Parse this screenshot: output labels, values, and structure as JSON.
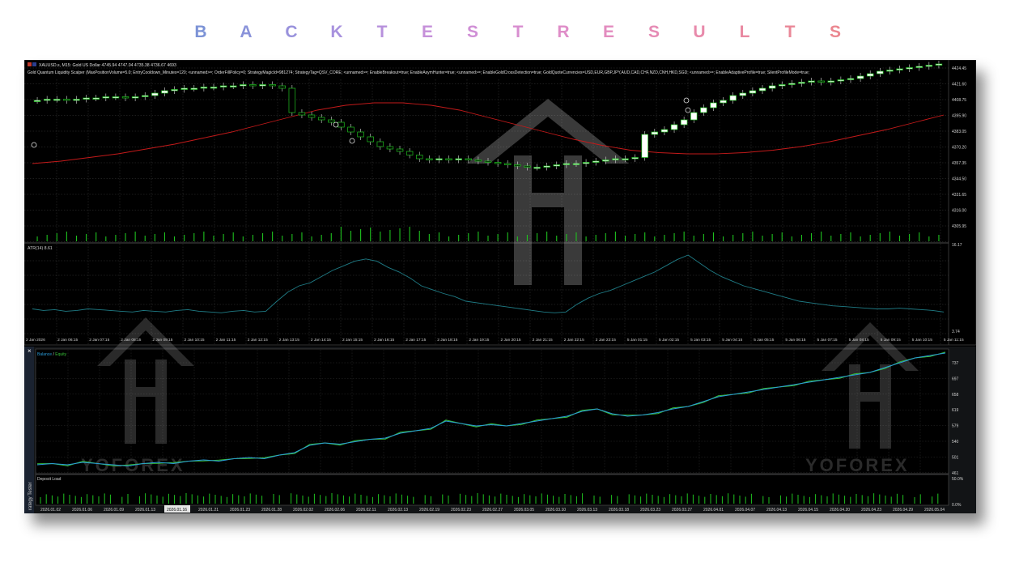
{
  "banner": {
    "letters": [
      "B",
      "A",
      "C",
      "K",
      "T",
      "E",
      "S",
      "T",
      "R",
      "E",
      "S",
      "U",
      "L",
      "T",
      "S"
    ],
    "colors": [
      "#7c93d6",
      "#8a93da",
      "#9992dc",
      "#a892de",
      "#b791dc",
      "#c690da",
      "#d08fd6",
      "#d88ed0",
      "#df8dc8",
      "#e38cbf",
      "#e68bb5",
      "#e88aab",
      "#e989a1",
      "#ea8898",
      "#eb8790"
    ]
  },
  "chart_window": {
    "symbol_line": "XAUUSD.s, M15: Gold US Dollar  4745.94 4747.04 4735.38 4736.67  4693",
    "ea_line": "Gold Quantum Liquidity Scalper (MaxPositionVolume=5.0; EntryCooldown_Minutes=120; <unnamed>=; OrderFillPolicy=0; StrategyMagicId=981274; StrategyTag=QSV_CORE; <unnamed>=; EnableBreakout=true; EnableAsymHunter=true; <unnamed>=; EnableGoldCrossDetection=true; GoldQuoteCurrencies=USD,EUR,GBP,JPY,AUD,CAD,CHF,NZD,CNH,HKD,SGD; <unnamed>=; EnableAdaptiveProfile=true; SilentProfileMode=true;",
    "price_ticks": [
      "4424.45",
      "4421.60",
      "4408.75",
      "4395.90",
      "4383.05",
      "4370.20",
      "4357.35",
      "4344.50",
      "4331.65",
      "4316.00",
      "4305.95"
    ],
    "atr_label": "ATR(14) 8.61",
    "atr_ticks": [
      "16.17",
      "3.74"
    ],
    "time_ticks": [
      "2 Jan 2026",
      "2 Jan 06:15",
      "2 Jan 07:15",
      "2 Jan 08:15",
      "2 Jan 09:15",
      "2 Jan 10:15",
      "2 Jan 11:15",
      "2 Jan 12:15",
      "2 Jan 13:15",
      "2 Jan 14:15",
      "2 Jan 15:15",
      "2 Jan 16:15",
      "2 Jan 17:15",
      "2 Jan 18:15",
      "2 Jan 19:15",
      "2 Jan 20:15",
      "2 Jan 21:15",
      "2 Jan 22:15",
      "2 Jan 23:15",
      "5 Jan 01:15",
      "5 Jan 02:15",
      "5 Jan 03:15",
      "5 Jan 04:15",
      "5 Jan 05:15",
      "5 Jan 06:15",
      "5 Jan 07:15",
      "5 Jan 08:15",
      "5 Jan 09:15",
      "5 Jan 10:15",
      "5 Jan 11:15"
    ]
  },
  "tester": {
    "close_glyph": "×",
    "legend_balance": "Balance",
    "legend_sep": " / ",
    "legend_equity": "Equity",
    "balance_ticks": [
      "737",
      "697",
      "658",
      "619",
      "579",
      "540",
      "501",
      "461"
    ],
    "deposit_label": "Deposit Load",
    "deposit_ticks": [
      "50.0%",
      "0.0%"
    ],
    "side_label": "rategy Tester",
    "date_ticks": [
      "2026.01.02",
      "2026.01.06",
      "2026.01.09",
      "2026.01.13",
      "2026.01.16",
      "2026.01.21",
      "2026.01.23",
      "2026.01.28",
      "2026.02.02",
      "2026.02.06",
      "2026.02.11",
      "2026.02.13",
      "2026.02.19",
      "2026.02.23",
      "2026.02.27",
      "2026.03.05",
      "2026.03.10",
      "2026.03.13",
      "2026.03.18",
      "2026.03.23",
      "2026.03.27",
      "2026.04.01",
      "2026.04.07",
      "2026.04.13",
      "2026.04.15",
      "2026.04.20",
      "2026.04.23",
      "2026.04.29",
      "2026.05.04"
    ],
    "selected_date_index": 4
  },
  "watermark": {
    "brand": "YOFOREX"
  },
  "colors": {
    "bull": "#ffffff",
    "bear": "#1fc21f",
    "ma": "#c41a1a",
    "atr": "#1f7c86",
    "balance": "#2a9bd8",
    "equity": "#38c138",
    "volume": "#1fc21f",
    "grid": "#3a3a3a"
  }
}
